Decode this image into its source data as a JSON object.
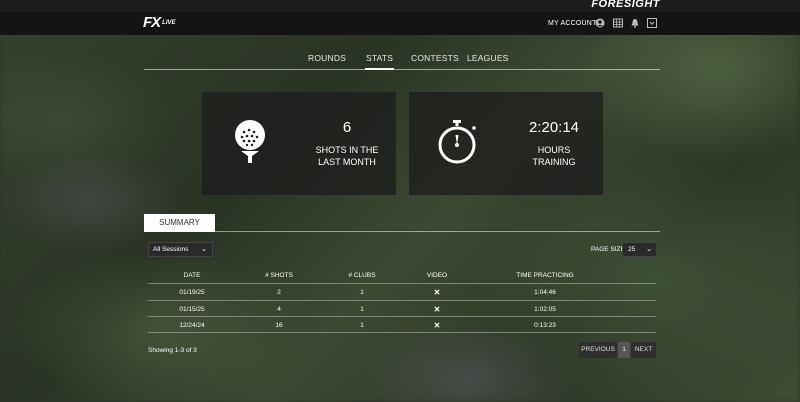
{
  "brand": {
    "company": "FORESIGHT",
    "app_logo": "FX",
    "app_logo_suffix": "LIVE"
  },
  "header": {
    "my_account": "MY ACCOUNT",
    "icons": [
      "account-circle-icon",
      "grid-icon",
      "bell-icon",
      "dropdown-square-icon"
    ]
  },
  "nav": {
    "tabs": [
      {
        "label": "ROUNDS",
        "active": false
      },
      {
        "label": "STATS",
        "active": true
      },
      {
        "label": "CONTESTS",
        "active": false
      },
      {
        "label": "LEAGUES",
        "active": false
      }
    ]
  },
  "stats": {
    "shots": {
      "value": "6",
      "label_line1": "SHOTS IN THE",
      "label_line2": "LAST MONTH",
      "icon": "golf-ball-on-tee-icon"
    },
    "training": {
      "value": "2:20:14",
      "label_line1": "HOURS",
      "label_line2": "TRAINING",
      "icon": "stopwatch-icon"
    }
  },
  "summary": {
    "tab_label": "SUMMARY",
    "sessions_filter": "All Sessions",
    "page_size_label": "PAGE SIZE",
    "page_size_value": "25",
    "columns": [
      "DATE",
      "# SHOTS",
      "# CLUBS",
      "VIDEO",
      "TIME PRACTICING"
    ],
    "rows": [
      {
        "date": "01/19/25",
        "shots": "2",
        "clubs": "1",
        "video": "✕",
        "time": "1:04:46"
      },
      {
        "date": "01/15/25",
        "shots": "4",
        "clubs": "1",
        "video": "✕",
        "time": "1:02:05"
      },
      {
        "date": "12/24/24",
        "shots": "16",
        "clubs": "1",
        "video": "✕",
        "time": "0:13:23"
      }
    ],
    "showing": "Showing 1-3 of 3",
    "pagination": {
      "previous": "PREVIOUS",
      "page": "1",
      "next": "NEXT"
    }
  }
}
